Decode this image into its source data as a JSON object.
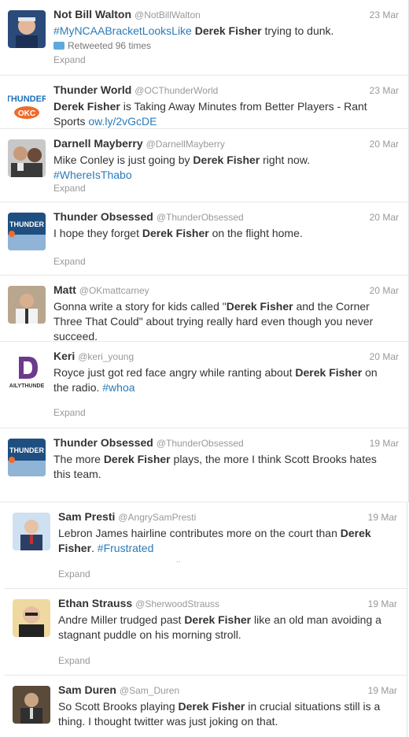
{
  "tweets": [
    {
      "name": "Not Bill Walton",
      "handle": "@NotBillWalton",
      "date": "23 Mar",
      "parts": [
        {
          "t": "#MyNCAABracketLooksLike",
          "s": "link"
        },
        {
          "t": " "
        },
        {
          "t": "Derek Fisher",
          "s": "bold"
        },
        {
          "t": " trying to dunk."
        }
      ],
      "retweeted": "Retweeted 96 times",
      "expand": "Expand"
    },
    {
      "name": "Thunder World",
      "handle": "@OCThunderWorld",
      "date": "23 Mar",
      "parts": [
        {
          "t": "Derek Fisher",
          "s": "bold"
        },
        {
          "t": " is Taking Away Minutes from Better Players - Rant Sports "
        },
        {
          "t": "ow.ly/2vGcDE",
          "s": "link"
        }
      ],
      "expand": ""
    },
    {
      "name": "Darnell Mayberry",
      "handle": "@DarnellMayberry",
      "date": "20 Mar",
      "parts": [
        {
          "t": "Mike Conley is just going by "
        },
        {
          "t": "Derek Fisher",
          "s": "bold"
        },
        {
          "t": " right now. "
        },
        {
          "t": "#WhereIsThabo",
          "s": "link"
        }
      ],
      "expand": "Expand"
    },
    {
      "name": "Thunder Obsessed",
      "handle": "@ThunderObsessed",
      "date": "20 Mar",
      "parts": [
        {
          "t": "I hope they forget "
        },
        {
          "t": "Derek Fisher",
          "s": "bold"
        },
        {
          "t": " on the flight home."
        }
      ],
      "expand": "Expand"
    },
    {
      "name": "Matt",
      "handle": "@OKmattcarney",
      "date": "20 Mar",
      "parts": [
        {
          "t": "Gonna write a story for kids called \""
        },
        {
          "t": "Derek Fisher",
          "s": "bold"
        },
        {
          "t": " and the Corner Three That Could\" about trying really hard even though you never succeed."
        }
      ],
      "expand": ""
    },
    {
      "name": "Keri",
      "handle": "@keri_young",
      "date": "20 Mar",
      "parts": [
        {
          "t": "Royce just got red face angry while ranting about "
        },
        {
          "t": "Derek Fisher",
          "s": "bold"
        },
        {
          "t": " on the radio. "
        },
        {
          "t": "#whoa",
          "s": "link"
        }
      ],
      "avatar_label": "AILYTHUNDE",
      "expand": "Expand"
    },
    {
      "name": "Thunder Obsessed",
      "handle": "@ThunderObsessed",
      "date": "19 Mar",
      "parts": [
        {
          "t": "The more "
        },
        {
          "t": "Derek Fisher",
          "s": "bold"
        },
        {
          "t": " plays, the more I think Scott Brooks hates this team."
        }
      ],
      "expand": ""
    },
    {
      "name": "Sam Presti",
      "handle": "@AngrySamPresti",
      "date": "19 Mar",
      "parts": [
        {
          "t": "Lebron James hairline contributes more on the court than "
        },
        {
          "t": "Derek Fisher",
          "s": "bold"
        },
        {
          "t": ". "
        },
        {
          "t": "#Frustrated",
          "s": "link"
        }
      ],
      "expand": "Expand"
    },
    {
      "name": "Ethan Strauss",
      "handle": "@SherwoodStrauss",
      "date": "19 Mar",
      "parts": [
        {
          "t": "Andre Miller trudged past "
        },
        {
          "t": "Derek Fisher",
          "s": "bold"
        },
        {
          "t": " like an old man avoiding a stagnant puddle on his morning stroll."
        }
      ],
      "expand": "Expand"
    },
    {
      "name": "Sam Duren",
      "handle": "@Sam_Duren",
      "date": "19 Mar",
      "parts": [
        {
          "t": "So Scott Brooks playing "
        },
        {
          "t": "Derek Fisher",
          "s": "bold"
        },
        {
          "t": " in crucial situations still is a thing. I thought twitter was just joking on that."
        }
      ],
      "expand": ""
    }
  ]
}
